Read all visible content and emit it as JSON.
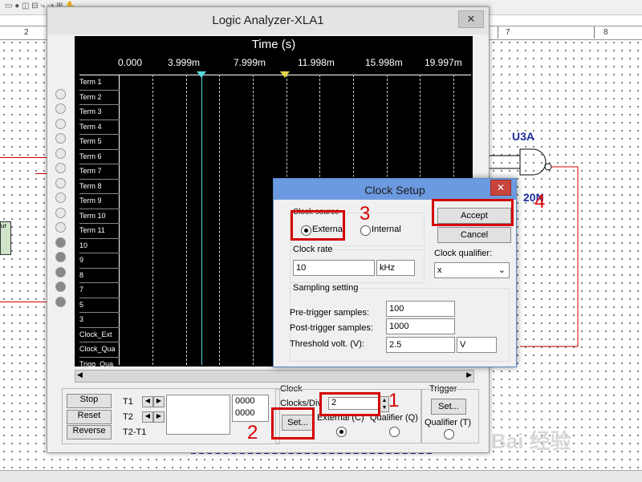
{
  "window": {
    "title": "Logic Analyzer-XLA1",
    "close_glyph": "✕"
  },
  "ruler": {
    "marks": [
      "2",
      "7",
      "8"
    ]
  },
  "display": {
    "axis_title": "Time (s)",
    "ticks": [
      "0.000",
      "3.999m",
      "7.999m",
      "11.998m",
      "15.998m",
      "19.997m"
    ],
    "terms": [
      "Term 1",
      "Term 2",
      "Term 3",
      "Term 4",
      "Term 5",
      "Term 6",
      "Term 7",
      "Term 8",
      "Term 9",
      "Term 10",
      "Term 11",
      "10",
      "9",
      "8",
      "7",
      "5",
      "3",
      "Clock_Ext",
      "Clock_Qua",
      "Trigg_Qua"
    ]
  },
  "controls": {
    "stop": "Stop",
    "reset": "Reset",
    "reverse": "Reverse",
    "t1": "T1",
    "t2": "T2",
    "t2t1": "T2-T1",
    "t1_value": "0000",
    "t2_value": "0000",
    "clock_group": "Clock",
    "clocks_div": "Clocks/Div",
    "clocks_div_value": "2",
    "set": "Set...",
    "external": "External (C)",
    "qualifier": "Qualifier (Q)",
    "trigger_group": "Trigger",
    "trigger_set": "Set...",
    "trigger_qualifier": "Qualifier (T)"
  },
  "schematic": {
    "gate_label": "U3A",
    "gate_part": "20N"
  },
  "dialog": {
    "title": "Clock Setup",
    "close_glyph": "✕",
    "clock_source_label": "Clock source",
    "external": "External",
    "internal": "Internal",
    "accept": "Accept",
    "cancel": "Cancel",
    "clock_rate_label": "Clock rate",
    "clock_rate_value": "10",
    "clock_rate_unit": "kHz",
    "clock_qualifier_label": "Clock qualifier:",
    "clock_qualifier_value": "x",
    "sampling_label": "Sampling setting",
    "pre_trigger_label": "Pre-trigger samples:",
    "pre_trigger_value": "100",
    "post_trigger_label": "Post-trigger samples:",
    "post_trigger_value": "1000",
    "threshold_label": "Threshold volt. (V):",
    "threshold_value": "2.5",
    "threshold_unit": "V"
  },
  "annotations": {
    "n1": "1",
    "n2": "2",
    "n3": "3",
    "n4": "4"
  },
  "watermark": "Bai 经验"
}
